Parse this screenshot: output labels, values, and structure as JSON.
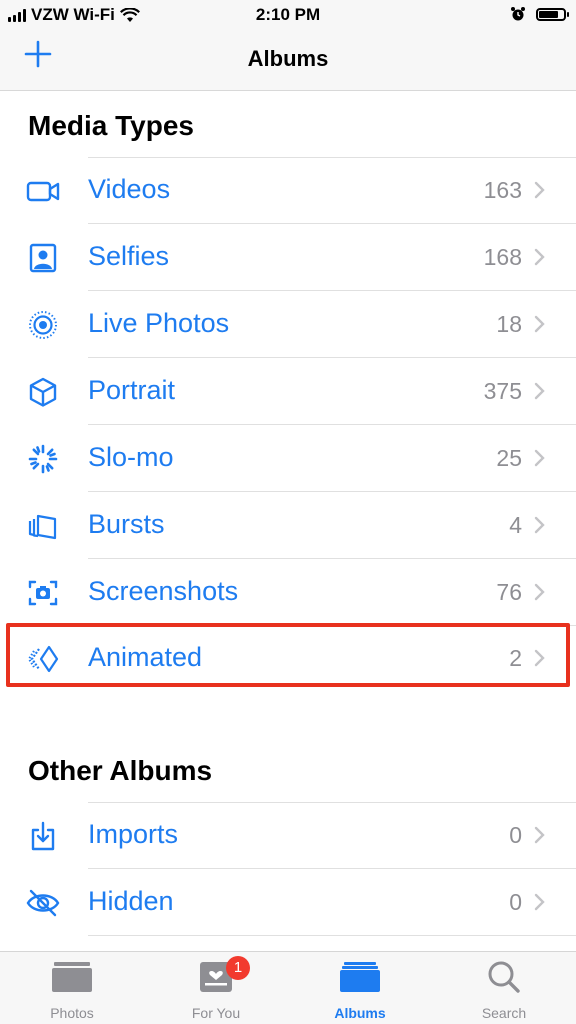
{
  "status_bar": {
    "carrier": "VZW Wi-Fi",
    "time": "2:10 PM"
  },
  "nav": {
    "title": "Albums",
    "add_label": "+"
  },
  "media_types": {
    "title": "Media Types",
    "items": [
      {
        "label": "Videos",
        "count": "163",
        "icon": "video-icon"
      },
      {
        "label": "Selfies",
        "count": "168",
        "icon": "selfie-icon"
      },
      {
        "label": "Live Photos",
        "count": "18",
        "icon": "live-photos-icon"
      },
      {
        "label": "Portrait",
        "count": "375",
        "icon": "portrait-cube-icon"
      },
      {
        "label": "Slo-mo",
        "count": "25",
        "icon": "slomo-icon"
      },
      {
        "label": "Bursts",
        "count": "4",
        "icon": "bursts-icon"
      },
      {
        "label": "Screenshots",
        "count": "76",
        "icon": "screenshot-icon"
      },
      {
        "label": "Animated",
        "count": "2",
        "icon": "animated-icon"
      }
    ]
  },
  "other_albums": {
    "title": "Other Albums",
    "items": [
      {
        "label": "Imports",
        "count": "0",
        "icon": "import-icon"
      },
      {
        "label": "Hidden",
        "count": "0",
        "icon": "hidden-eye-icon"
      }
    ]
  },
  "tabs": [
    {
      "label": "Photos",
      "icon": "photos-tab-icon"
    },
    {
      "label": "For You",
      "icon": "for-you-tab-icon",
      "badge": "1"
    },
    {
      "label": "Albums",
      "icon": "albums-tab-icon"
    },
    {
      "label": "Search",
      "icon": "search-icon"
    }
  ],
  "colors": {
    "accent": "#1e7cf0",
    "highlight": "#e8311e",
    "badge": "#f23a2e"
  }
}
